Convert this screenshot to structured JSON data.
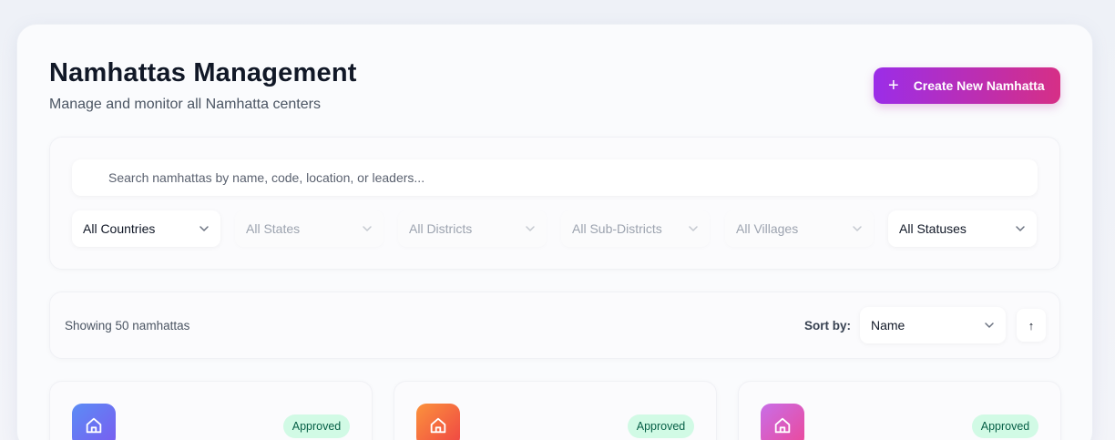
{
  "header": {
    "title": "Namhattas Management",
    "subtitle": "Manage and monitor all Namhatta centers",
    "create_button": {
      "icon": "plus-icon",
      "label": "Create New Namhatta"
    }
  },
  "filters": {
    "search_placeholder": "Search namhattas by name, code, location, or leaders...",
    "search_value": "",
    "selects": [
      {
        "label": "All Countries",
        "disabled": false
      },
      {
        "label": "All States",
        "disabled": true
      },
      {
        "label": "All Districts",
        "disabled": true
      },
      {
        "label": "All Sub-Districts",
        "disabled": true
      },
      {
        "label": "All Villages",
        "disabled": true
      },
      {
        "label": "All Statuses",
        "disabled": false
      }
    ]
  },
  "results": {
    "showing_text": "Showing 50 namhattas",
    "sort_label": "Sort by:",
    "sort_value": "Name",
    "sort_direction_icon": "↑"
  },
  "cards": [
    {
      "icon": "home-icon",
      "status": "Approved",
      "icon_gradient": [
        "#5b8cf5",
        "#7a5cf0"
      ]
    },
    {
      "icon": "home-icon",
      "status": "Approved",
      "icon_gradient": [
        "#fb923c",
        "#ef4444"
      ]
    },
    {
      "icon": "home-icon",
      "status": "Approved",
      "icon_gradient": [
        "#c86ee8",
        "#ec4899"
      ]
    }
  ],
  "colors": {
    "accent_start": "#9b2de8",
    "accent_end": "#d62f86",
    "badge_bg": "#d1fae5",
    "badge_text": "#065f46"
  }
}
